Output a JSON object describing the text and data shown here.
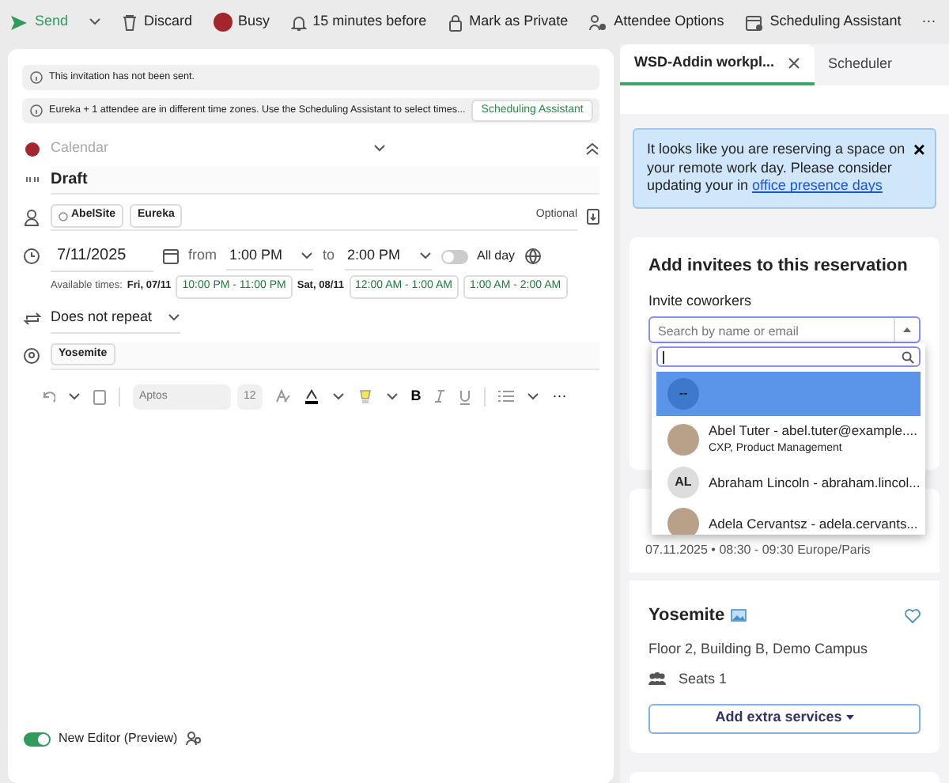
{
  "toolbar": [
    {
      "kind": "send",
      "label": "Send"
    },
    {
      "kind": "discard",
      "label": "Discard"
    },
    {
      "kind": "busy",
      "label": "Busy",
      "color": "#a4262c"
    },
    {
      "kind": "bell",
      "label": "15 minutes before"
    },
    {
      "kind": "lock",
      "label": "Mark as Private"
    },
    {
      "kind": "people",
      "label": "Attendee Options"
    },
    {
      "kind": "calendar",
      "label": "Scheduling Assistant"
    },
    {
      "kind": "more",
      "label": "···"
    }
  ],
  "notices": [
    {
      "text": "This invitation has not been sent."
    },
    {
      "text": "Eureka + 1 attendee are in different time zones. Use the Scheduling Assistant to select times...",
      "action": "Scheduling Assistant"
    }
  ],
  "form": {
    "calendar": {
      "placeholder": "Calendar",
      "color": "#a4262c"
    },
    "title": "Draft",
    "attendees": [
      {
        "name": "AbelSite",
        "organizer": true
      },
      {
        "name": "Eureka",
        "organizer": false
      }
    ],
    "optional": "Optional",
    "date": "7/11/2025",
    "from_label": "from",
    "start": "1:00 PM",
    "to_label": "to",
    "end": "2:00 PM",
    "all_day": {
      "label": "All day",
      "on": false
    },
    "available_label": "Available times:",
    "available": [
      {
        "day": "Fri, 07/11",
        "slots": [
          "10:00 PM - 11:00 PM"
        ]
      },
      {
        "day": "Sat, 08/11",
        "slots": [
          "12:00 AM - 1:00 AM",
          "1:00 AM - 2:00 AM"
        ]
      }
    ],
    "repeat": "Does not repeat",
    "locations": [
      "Yosemite"
    ]
  },
  "editor_toolbar": {
    "font": "Aptos",
    "size": "12",
    "bold": "B",
    "more": "···"
  },
  "footer": {
    "label": "New Editor (Preview)",
    "on": true
  },
  "tabs": [
    {
      "label": "WSD-Addin workpl...",
      "selected": true,
      "closable": true
    },
    {
      "label": "Scheduler",
      "selected": false,
      "closable": false
    }
  ],
  "alert": {
    "text": "It looks like you are reserving a space on your remote work day. Please consider updating your in ",
    "link": "office presence days",
    "close": "×"
  },
  "invite_card": {
    "title": "Add invitees to this reservation",
    "label": "Invite coworkers",
    "select_placeholder": "Search by name or email",
    "options": [
      {
        "kind": "empty",
        "label": "--",
        "selected": true
      },
      {
        "kind": "photo",
        "label": "Abel Tuter - abel.tuter@example....",
        "subtitle": "CXP, Product Management",
        "selected": false
      },
      {
        "kind": "initials",
        "initials": "AL",
        "label": "Abraham Lincoln - abraham.lincol...",
        "selected": false
      },
      {
        "kind": "photo",
        "label": "Adela Cervantsz - adela.cervants...",
        "selected": false
      }
    ]
  },
  "reservation": {
    "when": "07.11.2025 • 08:30 - 09:30 Europe/Paris",
    "room": "Yosemite",
    "favorite": false,
    "address": "Floor 2, Building B, Demo Campus",
    "seats": "Seats 1",
    "button": "Add extra services"
  }
}
